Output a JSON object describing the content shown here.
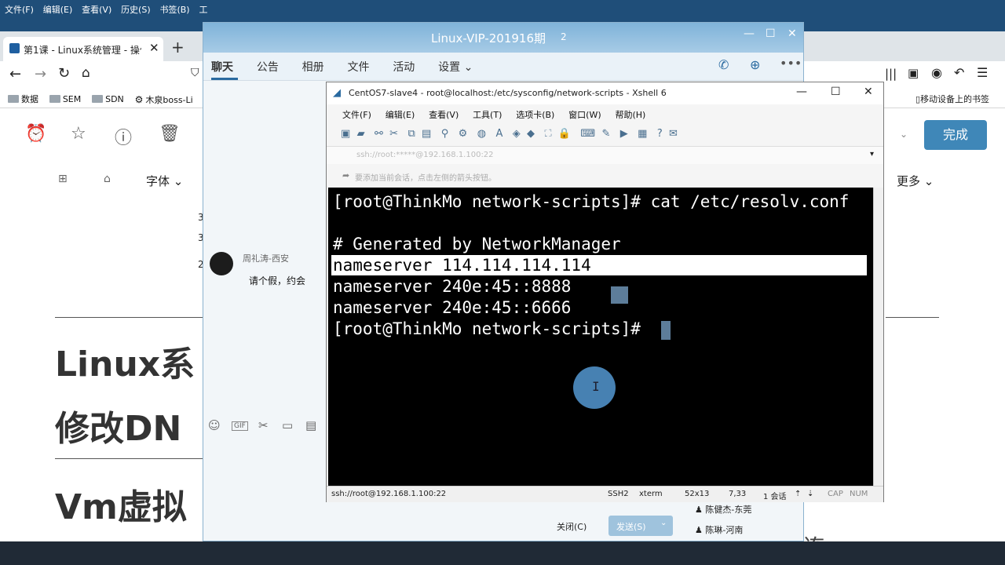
{
  "browser": {
    "menu": [
      "文件(F)",
      "编辑(E)",
      "查看(V)",
      "历史(S)",
      "书签(B)",
      "工"
    ],
    "tab_title": "第1课 - Linux系统管理 - 操作",
    "bookmarks": [
      "数据",
      "SEM",
      "SDN",
      "木泉boss-Li"
    ],
    "right_bookmark": "移动设备上的书签",
    "font_menu": "字体",
    "more_menu": "更多",
    "done_button": "完成",
    "doc_lines": [
      "Linux系",
      "修改DN",
      "Vm虚拟"
    ],
    "bottom_text": "虚拟机  连",
    "margin_numbers": [
      "3",
      "3",
      "2"
    ]
  },
  "qq": {
    "title": "Linux-VIP-201916期",
    "member_count": "2",
    "tabs": [
      "聊天",
      "公告",
      "相册",
      "文件",
      "活动",
      "设置"
    ],
    "chat_user": "周礼涛-西安",
    "chat_message": "请个假，约会",
    "close_button": "关闭(C)",
    "send_button": "发送(S)",
    "members": [
      "陈健杰-东莞",
      "陈琳-河南"
    ]
  },
  "xshell": {
    "title": "CentOS7-slave4 - root@localhost:/etc/sysconfig/network-scripts - Xshell 6",
    "menu": [
      "文件(F)",
      "编辑(E)",
      "查看(V)",
      "工具(T)",
      "选项卡(B)",
      "窗口(W)",
      "帮助(H)"
    ],
    "address": "ssh://root:*****@192.168.1.100:22",
    "info": "要添加当前会话，点击左侧的箭头按钮。",
    "terminal_lines": [
      "[root@ThinkMo network-scripts]# cat /etc/resolv.conf",
      "",
      "# Generated by NetworkManager",
      "nameserver 114.114.114.114",
      "nameserver 240e:45::8888",
      "nameserver 240e:45::6666",
      "[root@ThinkMo network-scripts]# "
    ],
    "highlighted_line": 3,
    "status": {
      "connection": "ssh://root@192.168.1.100:22",
      "protocol": "SSH2",
      "term": "xterm",
      "size": "52x13",
      "cursor": "7,33",
      "sessions": "1 会话",
      "caps": "CAP",
      "num": "NUM"
    }
  },
  "colors": {
    "qq_title": "#7fb3d9",
    "terminal_bg": "#000000",
    "terminal_fg": "#ffffff",
    "highlight": "#ffffff",
    "done_button": "#3f87b8",
    "pointer": "#4f8fc6"
  }
}
